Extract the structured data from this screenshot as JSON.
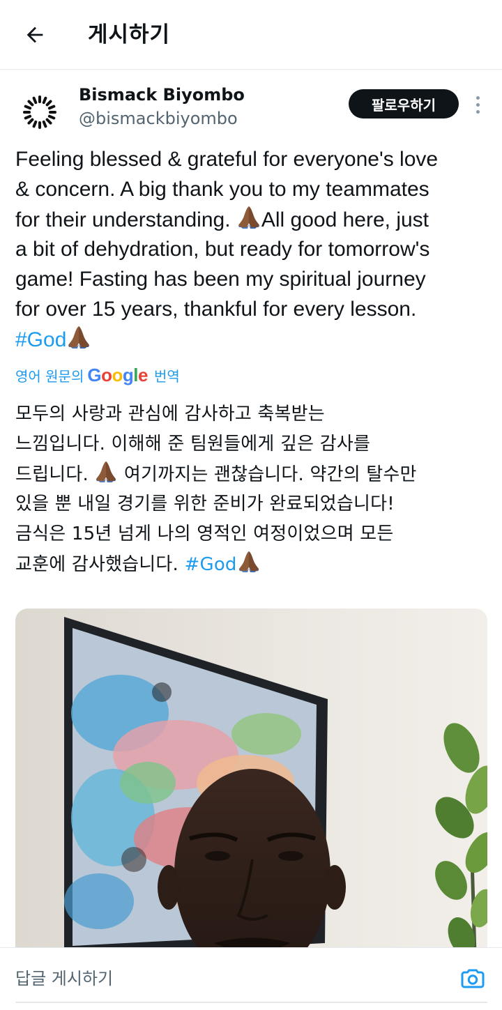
{
  "header": {
    "title": "게시하기"
  },
  "author": {
    "name": "Bismack Biyombo",
    "handle": "@bismackbiyombo"
  },
  "follow_label": "팔로우하기",
  "tweet": {
    "lines": [
      "Feeling blessed & grateful for everyone's love",
      "& concern. A big thank you to my teammates",
      "for their understanding. ",
      "All good here, just",
      "a bit of dehydration, but ready for tomorrow's",
      "game! Fasting has been my spiritual journey",
      "for over 15 years, thankful for every lesson."
    ],
    "hashtag": "#God"
  },
  "translate": {
    "prefix": "영어 원문의",
    "brand": [
      "G",
      "o",
      "o",
      "g",
      "l",
      "e"
    ],
    "suffix": "번역"
  },
  "translation": {
    "lines": [
      "모두의 사랑과 관심에 감사하고 축복받는",
      "느낌입니다. 이해해 준 팀원들에게 깊은 감사를",
      "드립니다. ",
      " 여기까지는 괜찮습니다. 약간의 탈수만",
      "있을 뿐 내일 경기를 위한 준비가 완료되었습니다!",
      "금식은 15년 넘게 나의 영적인 여정이었으며 모든",
      "교훈에 감사했습니다. "
    ],
    "hashtag": "#God"
  },
  "reply": {
    "placeholder": "답글 게시하기"
  },
  "icons": {
    "back": "arrow-left-icon",
    "more": "more-vertical-icon",
    "emoji": "folded-hands-emoji",
    "camera": "camera-icon"
  },
  "colors": {
    "link": "#1d9bf0",
    "follow_bg": "#0f1419",
    "secondary_text": "#536471"
  }
}
